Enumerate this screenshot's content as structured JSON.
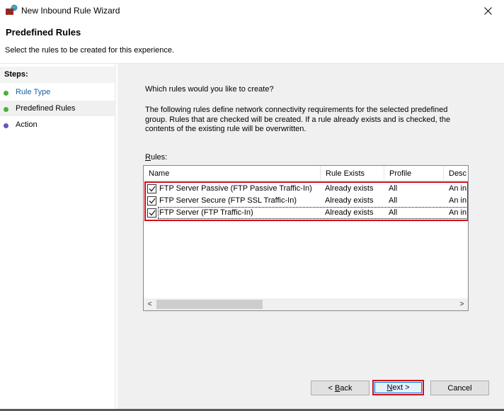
{
  "window": {
    "title": "New Inbound Rule Wizard",
    "app_icon": "firewall-globe-icon",
    "close_icon": "close-icon"
  },
  "header": {
    "title": "Predefined Rules",
    "subtitle": "Select the rules to be created for this experience."
  },
  "sidebar": {
    "steps_label": "Steps:",
    "steps": [
      {
        "label": "Rule Type",
        "state": "completed",
        "dot_color": "#4caf3c",
        "text_color": "#1f5fa0"
      },
      {
        "label": "Predefined Rules",
        "state": "current",
        "dot_color": "#4caf3c",
        "text_color": "#000000"
      },
      {
        "label": "Action",
        "state": "pending",
        "dot_color": "#6a55b8",
        "text_color": "#000000"
      }
    ]
  },
  "main": {
    "question": "Which rules would you like to create?",
    "description": "The following rules define network connectivity requirements for the selected predefined group. Rules that are checked will be created. If a rule already exists and is checked, the contents of the existing rule will be overwritten.",
    "rules_label_access": "R",
    "rules_label_rest": "ules:",
    "columns": [
      "Name",
      "Rule Exists",
      "Profile",
      "Desc"
    ],
    "rows": [
      {
        "checked": true,
        "name": "FTP Server Passive (FTP Passive Traffic-In)",
        "rule_exists": "Already exists",
        "profile": "All",
        "description": "An in"
      },
      {
        "checked": true,
        "name": "FTP Server Secure (FTP SSL Traffic-In)",
        "rule_exists": "Already exists",
        "profile": "All",
        "description": "An in"
      },
      {
        "checked": true,
        "name": "FTP Server (FTP Traffic-In)",
        "rule_exists": "Already exists",
        "profile": "All",
        "description": "An in"
      }
    ],
    "scroll_left": "<",
    "scroll_right": ">"
  },
  "buttons": {
    "back_prefix": "< ",
    "back_access": "B",
    "back_rest": "ack",
    "next_access": "N",
    "next_rest": "ext >",
    "cancel": "Cancel"
  },
  "colors": {
    "highlight": "#d0101e"
  }
}
